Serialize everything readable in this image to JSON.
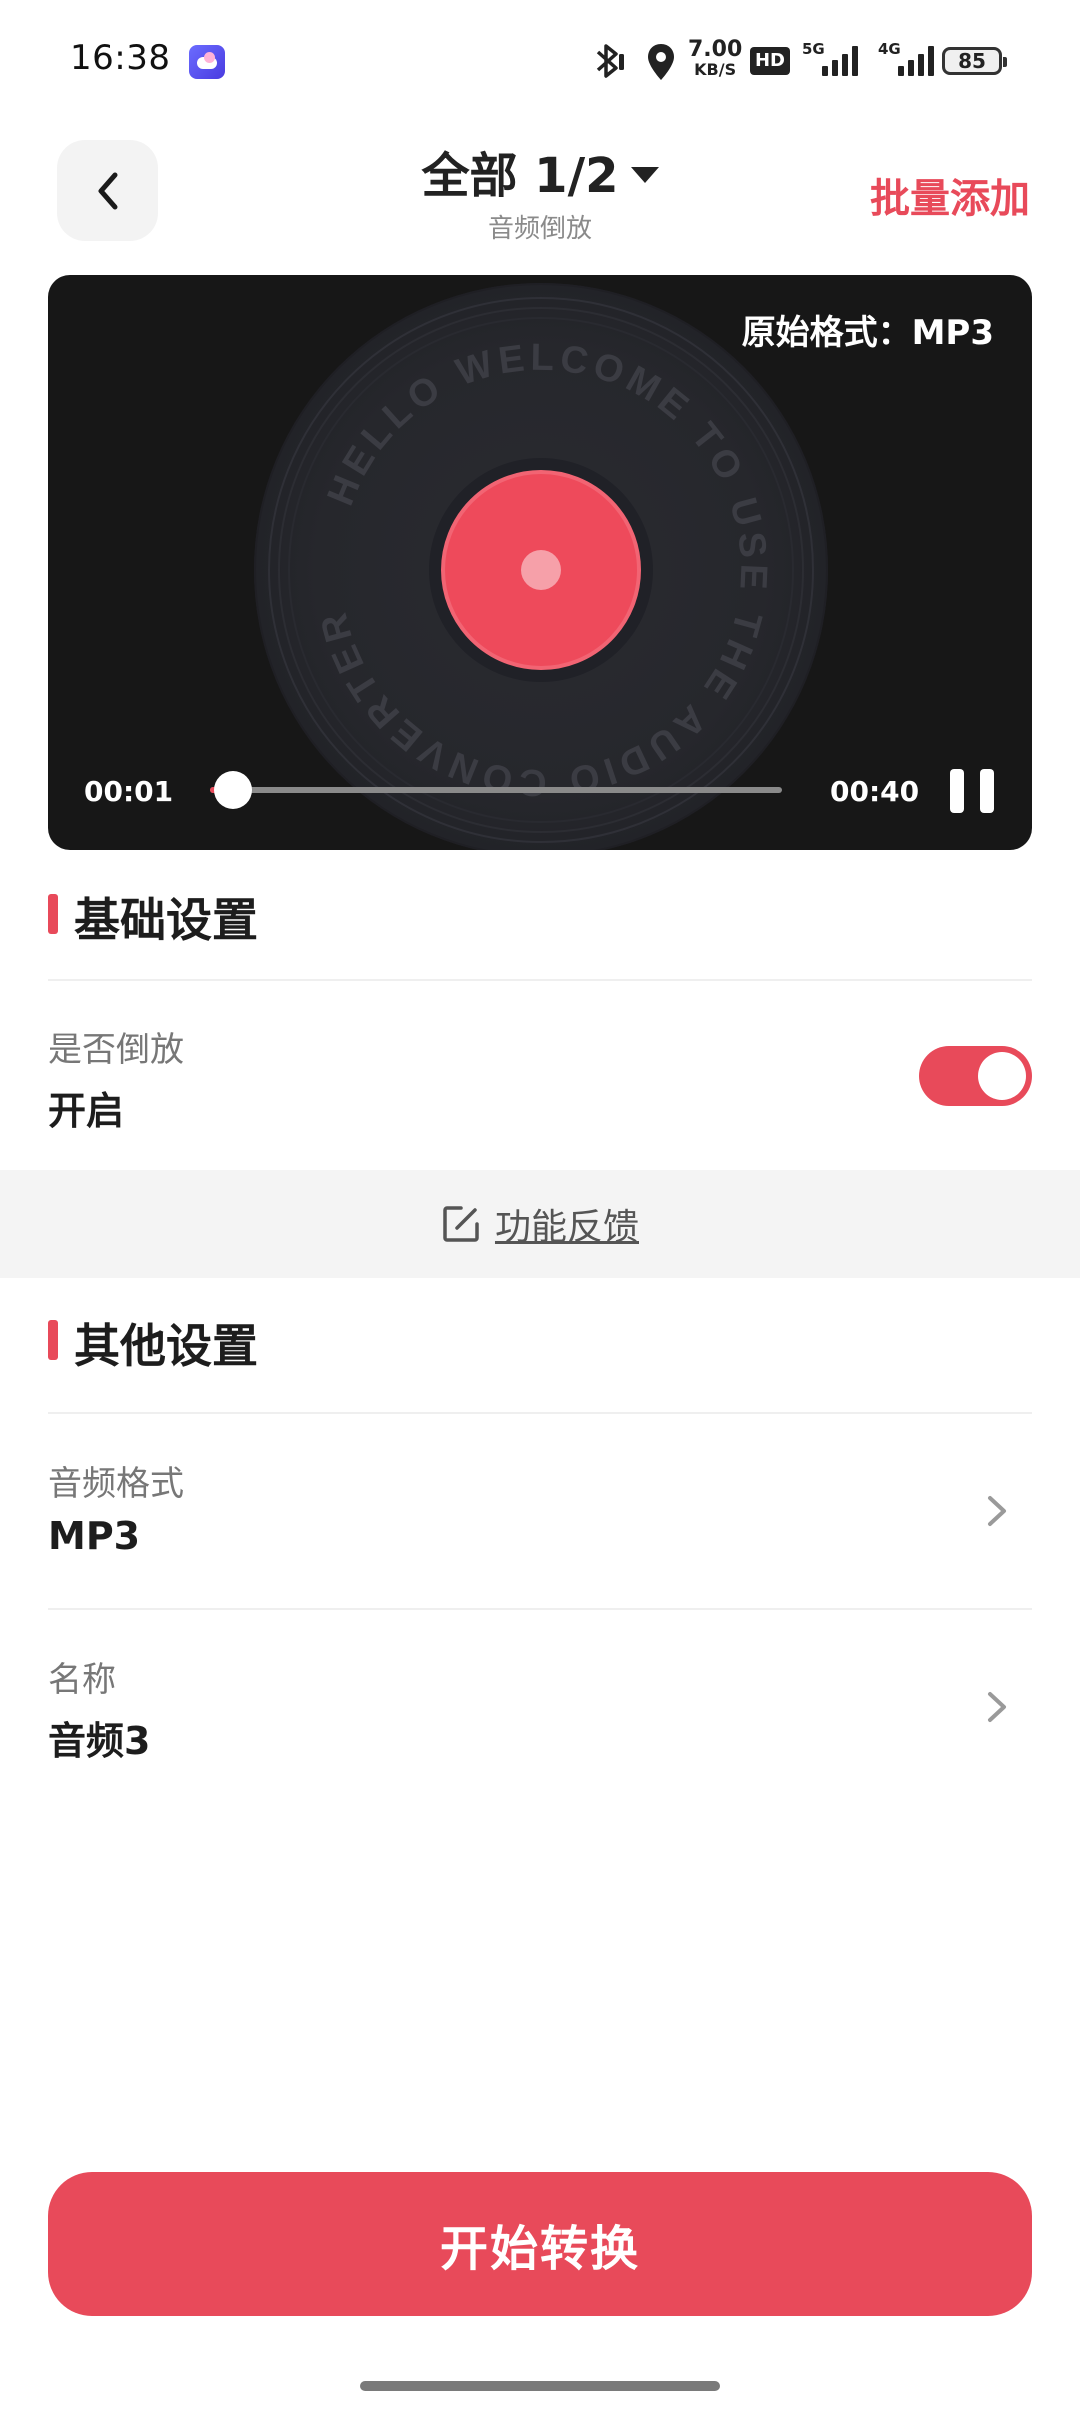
{
  "status_bar": {
    "time": "16:38",
    "net_speed": "7.00",
    "net_speed_unit": "KB/S",
    "hd_label": "HD",
    "signal_1_label": "5G",
    "signal_2_label": "4G",
    "battery": "85",
    "icons": [
      "bluetooth-icon",
      "location-icon",
      "signal-icon",
      "battery-icon"
    ]
  },
  "header": {
    "title": "全部 1/2",
    "subtitle": "音频倒放",
    "action": "批量添加"
  },
  "player": {
    "original_format": "原始格式：MP3",
    "record_text": "HELLO WELCOME TO USE THE AUDIO CONVERTER",
    "current_time": "00:01",
    "total_time": "00:40",
    "progress": 0.04,
    "state": "playing"
  },
  "basic_settings": {
    "title": "基础设置",
    "reverse_label": "是否倒放",
    "reverse_value": "开启",
    "reverse_on": true
  },
  "feedback": {
    "label": "功能反馈"
  },
  "other_settings": {
    "title": "其他设置",
    "format_label": "音频格式",
    "format_value": "MP3",
    "name_label": "名称",
    "name_value": "音频3"
  },
  "start_button": "开始转换",
  "colors": {
    "accent": "#e84a5a",
    "player_bg": "#171717",
    "record_center": "#ee4a5b"
  }
}
